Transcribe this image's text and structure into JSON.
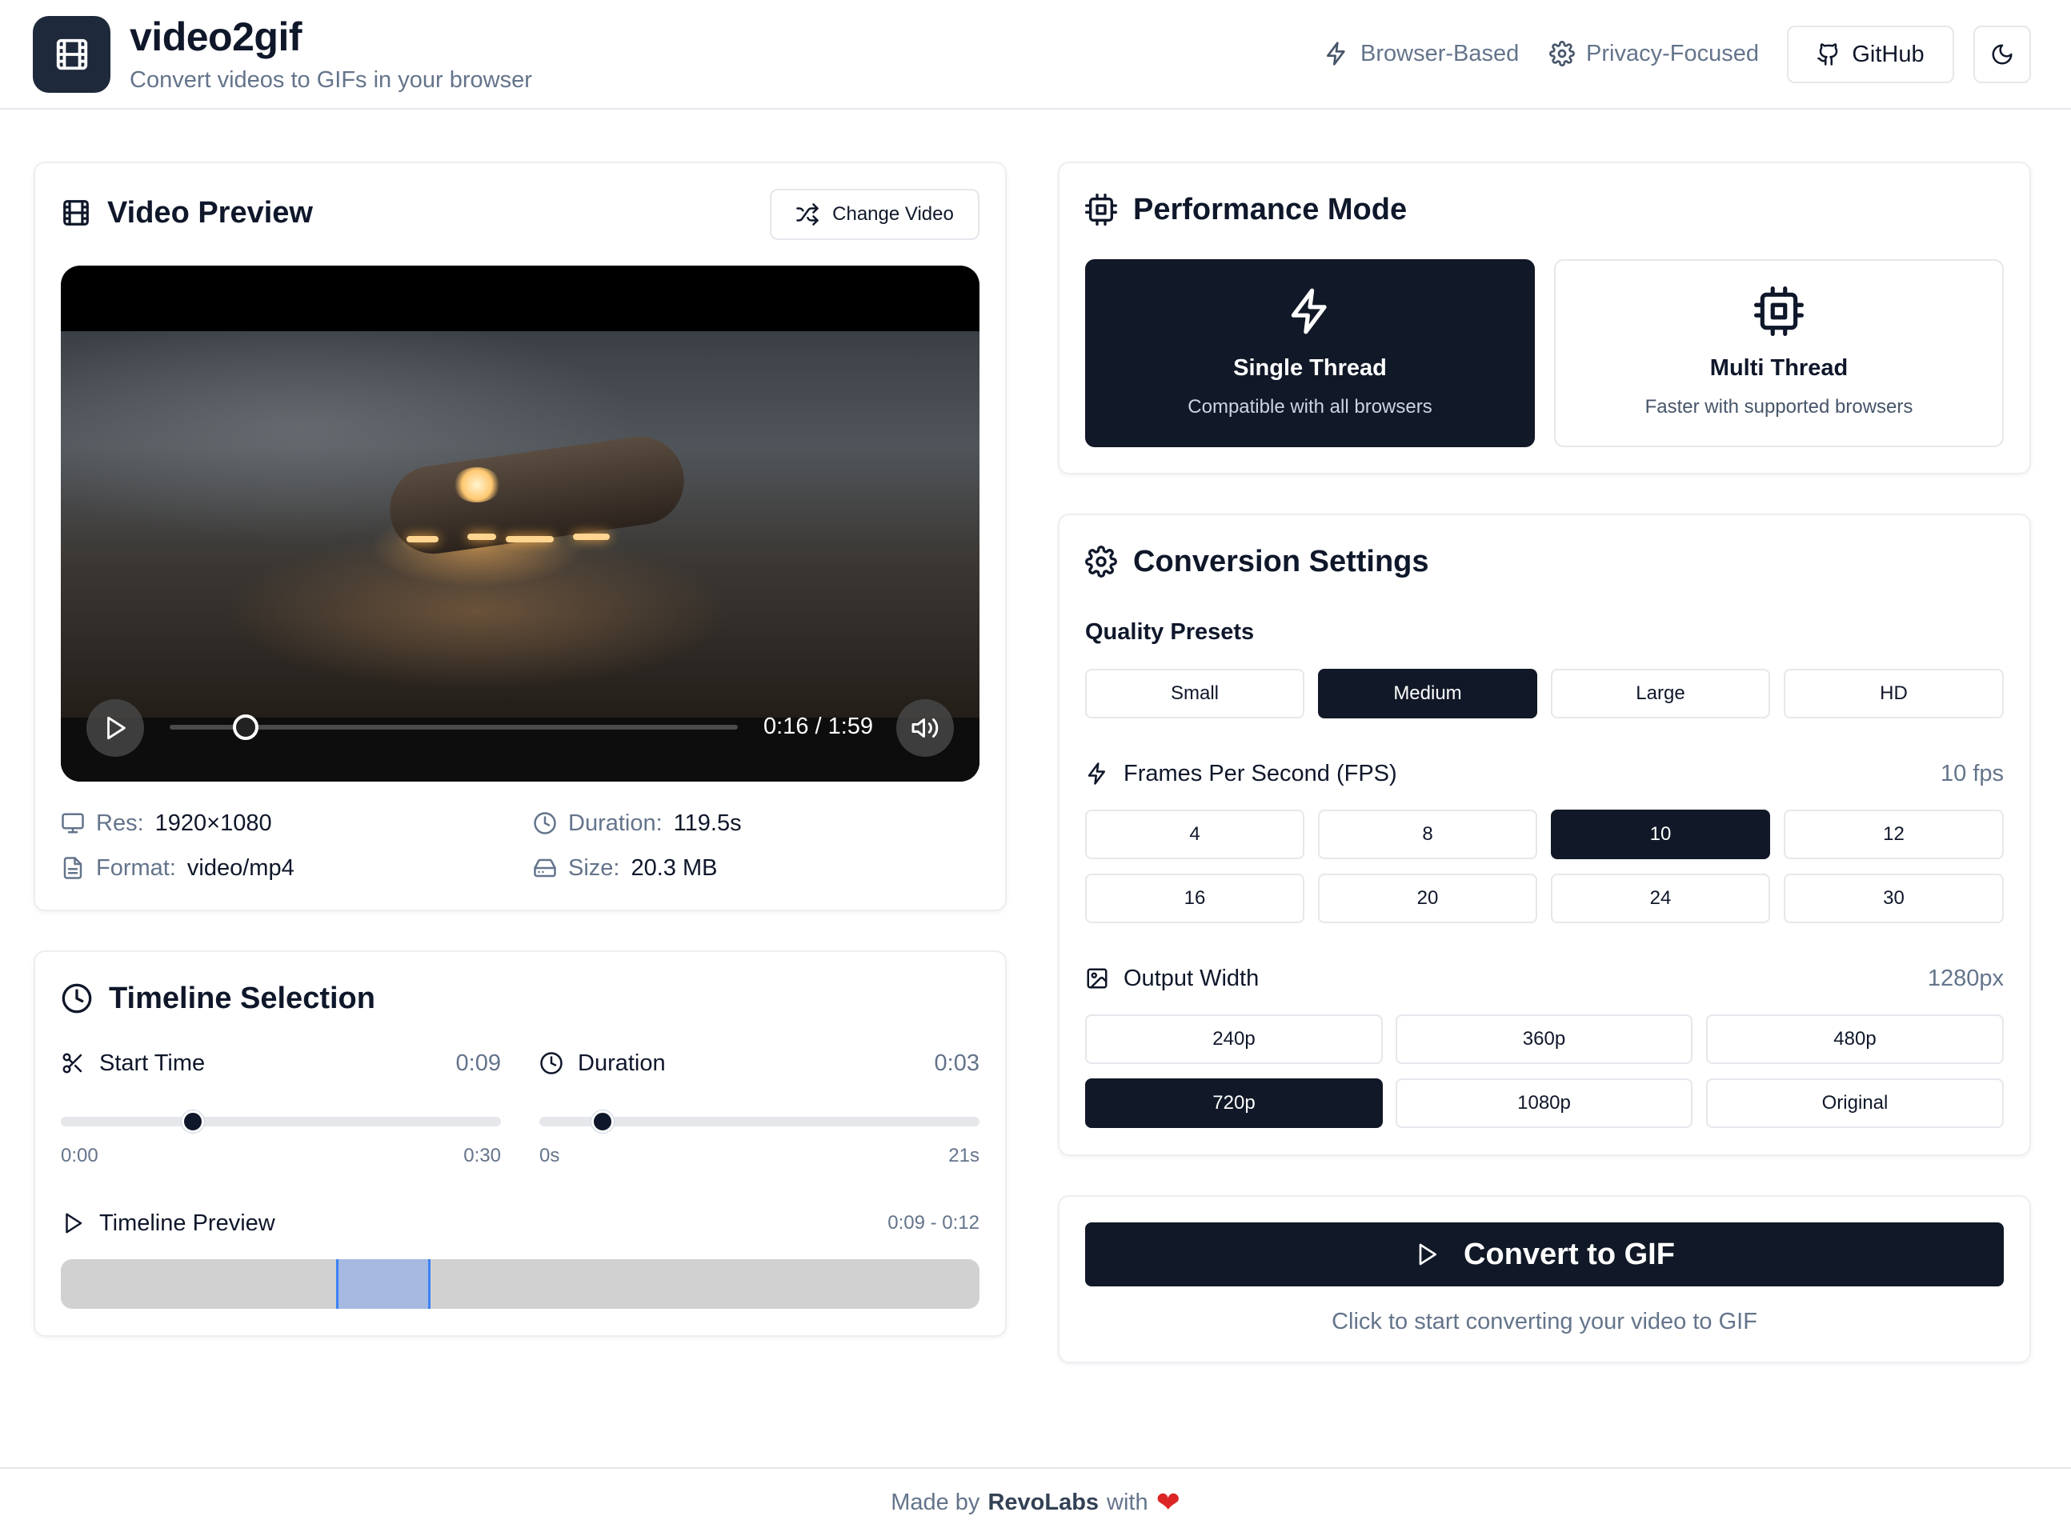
{
  "header": {
    "app_name": "video2gif",
    "tagline": "Convert videos to GIFs in your browser",
    "logo_icon": "film-icon",
    "links": [
      {
        "label": "Browser-Based",
        "icon": "zap-icon"
      },
      {
        "label": "Privacy-Focused",
        "icon": "gear-icon"
      }
    ],
    "github_label": "GitHub",
    "theme_toggle_icon": "moon-icon"
  },
  "video_preview": {
    "title": "Video Preview",
    "change_label": "Change Video",
    "player": {
      "time_display": "0:16 / 1:59",
      "progress": 0.134
    },
    "meta": {
      "res_label": "Res:",
      "res_value": "1920×1080",
      "duration_label": "Duration:",
      "duration_value": "119.5s",
      "format_label": "Format:",
      "format_value": "video/mp4",
      "size_label": "Size:",
      "size_value": "20.3 MB"
    }
  },
  "timeline": {
    "title": "Timeline Selection",
    "start": {
      "label": "Start Time",
      "value": "0:09",
      "min": "0:00",
      "max": "0:30",
      "fraction": 0.3
    },
    "duration": {
      "label": "Duration",
      "value": "0:03",
      "min": "0s",
      "max": "21s",
      "fraction": 0.143
    },
    "preview_label": "Timeline Preview",
    "preview_range": "0:09 - 0:12"
  },
  "performance": {
    "title": "Performance Mode",
    "modes": [
      {
        "title": "Single Thread",
        "desc": "Compatible with all browsers",
        "icon": "zap-icon",
        "active": true
      },
      {
        "title": "Multi Thread",
        "desc": "Faster with supported browsers",
        "icon": "cpu-icon",
        "active": false
      }
    ]
  },
  "conversion": {
    "title": "Conversion Settings",
    "quality_label": "Quality Presets",
    "quality": [
      "Small",
      "Medium",
      "Large",
      "HD"
    ],
    "quality_selected": "Medium",
    "fps_label": "Frames Per Second (FPS)",
    "fps_value": "10 fps",
    "fps": [
      "4",
      "8",
      "10",
      "12",
      "16",
      "20",
      "24",
      "30"
    ],
    "fps_selected": "10",
    "width_label": "Output Width",
    "width_value": "1280px",
    "widths": [
      "240p",
      "360p",
      "480p",
      "720p",
      "1080p",
      "Original"
    ],
    "width_selected": "720p"
  },
  "convert": {
    "button_label": "Convert to GIF",
    "hint": "Click to start converting your video to GIF"
  },
  "footer": {
    "prefix": "Made by",
    "brand": "RevoLabs",
    "suffix": "with",
    "heart": "❤"
  },
  "colors": {
    "primary": "#111827",
    "muted": "#64748b",
    "selection": "#a6b9e0",
    "selection_border": "#3b82f6",
    "heart": "#dc2626"
  }
}
